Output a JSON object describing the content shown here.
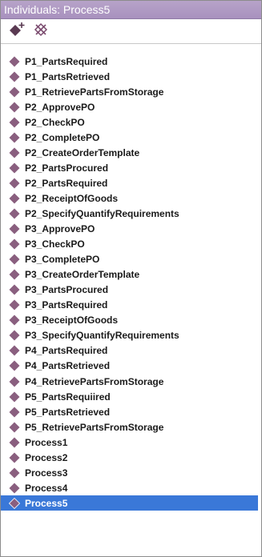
{
  "panel": {
    "title": "Individuals: Process5"
  },
  "toolbar": {
    "buttons": [
      {
        "icon": "add-individual-icon"
      },
      {
        "icon": "delete-individual-icon"
      }
    ]
  },
  "colors": {
    "title_bar": "#a892bd",
    "diamond": "#8a5f7f",
    "selection": "#3a78d8"
  },
  "individuals": [
    "P1_PartsRequired",
    "P1_PartsRetrieved",
    "P1_RetrievePartsFromStorage",
    "P2_ApprovePO",
    "P2_CheckPO",
    "P2_CompletePO",
    "P2_CreateOrderTemplate",
    "P2_PartsProcured",
    "P2_PartsRequired",
    "P2_ReceiptOfGoods",
    "P2_SpecifyQuantifyRequirements",
    "P3_ApprovePO",
    "P3_CheckPO",
    "P3_CompletePO",
    "P3_CreateOrderTemplate",
    "P3_PartsProcured",
    "P3_PartsRequired",
    "P3_ReceiptOfGoods",
    "P3_SpecifyQuantifyRequirements",
    "P4_PartsRequired",
    "P4_PartsRetrieved",
    "P4_RetrievePartsFromStorage",
    "P5_PartsRequiired",
    "P5_PartsRetrieved",
    "P5_RetrievePartsFromStorage",
    "Process1",
    "Process2",
    "Process3",
    "Process4",
    "Process5"
  ],
  "selected": "Process5"
}
